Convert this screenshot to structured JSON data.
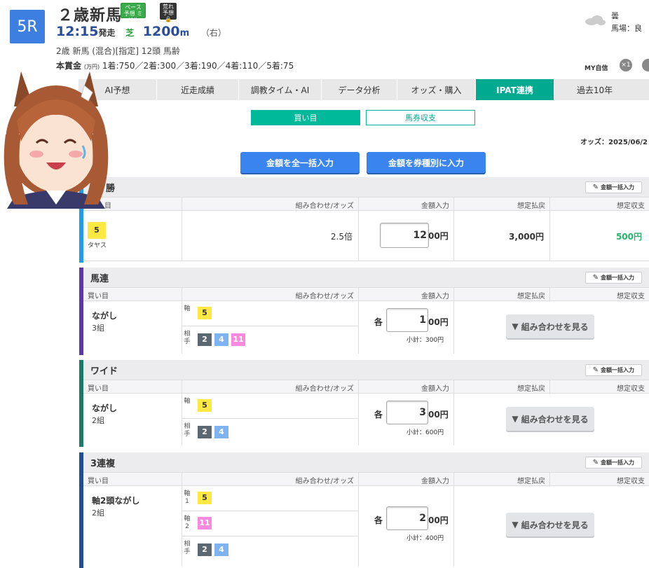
{
  "header": {
    "race_no": "5R",
    "title": "２歳新馬",
    "tag_pace": "ペース予想 ミドル",
    "tag_upset": "荒れ予想",
    "start_time": "12:15",
    "start_label": "発走",
    "surface": "芝",
    "distance": "1200",
    "distance_unit": "m",
    "direction": "（右）",
    "conditions": "2歳  新馬  (混合)[指定]  12頭  馬齢",
    "prize_label": "本賞金",
    "prize_unit": "(万円)",
    "prize_values": "1着:750／2着:300／3着:190／4着:110／5着:75"
  },
  "weather": {
    "weather_text": "曇",
    "track": "馬場：良"
  },
  "my_confidence": "MY自信",
  "x1_label": "×1",
  "tabs": [
    "AI予想",
    "近走成績",
    "調教タイム・AI",
    "データ分析",
    "オッズ・購入",
    "IPAT連携",
    "過去10年"
  ],
  "subtabs": {
    "buy": "買い目",
    "balance": "馬券収支"
  },
  "odds_date": "オッズ：2025/06/2",
  "buttons": {
    "all_amount": "金額を全一括入力",
    "by_type": "金額を券種別に入力",
    "bulk_input": "金額一括入力",
    "show_combos": "組み合わせを見る"
  },
  "columns": [
    "買い目",
    "組み合わせ/オッズ",
    "金額入力",
    "想定払戻",
    "想定収支"
  ],
  "win_block": {
    "title": "勝",
    "horse_no": "5",
    "horse_name": "タヤス",
    "odds": "2.5倍",
    "amount": "12",
    "amount_suffix": "00円",
    "payout": "3,000円",
    "profit": "500円",
    "color": "#1f9de8",
    "col1_head": "目"
  },
  "blocks": [
    {
      "title": "馬連",
      "color": "#5b3aa8",
      "bet_type": "ながし",
      "count": "3組",
      "rows": [
        {
          "label": "軸",
          "nums": [
            "5"
          ]
        },
        {
          "label": "相手",
          "nums": [
            "2",
            "4",
            "11"
          ]
        }
      ],
      "each": "各",
      "amount": "1",
      "amount_suffix": "00円",
      "subtotal": "小計：300円"
    },
    {
      "title": "ワイド",
      "color": "#1a7a66",
      "bet_type": "ながし",
      "count": "2組",
      "rows": [
        {
          "label": "軸",
          "nums": [
            "5"
          ]
        },
        {
          "label": "相手",
          "nums": [
            "2",
            "4"
          ]
        }
      ],
      "each": "各",
      "amount": "3",
      "amount_suffix": "00円",
      "subtotal": "小計：600円"
    },
    {
      "title": "3連複",
      "color": "#1f4e99",
      "bet_type": "軸2頭ながし",
      "count": "2組",
      "rows": [
        {
          "label": "軸1",
          "nums": [
            "5"
          ]
        },
        {
          "label": "軸2",
          "nums": [
            "11"
          ]
        },
        {
          "label": "相手",
          "nums": [
            "2",
            "4"
          ]
        }
      ],
      "each": "各",
      "amount": "2",
      "amount_suffix": "00円",
      "subtotal": "小計：400円"
    }
  ]
}
